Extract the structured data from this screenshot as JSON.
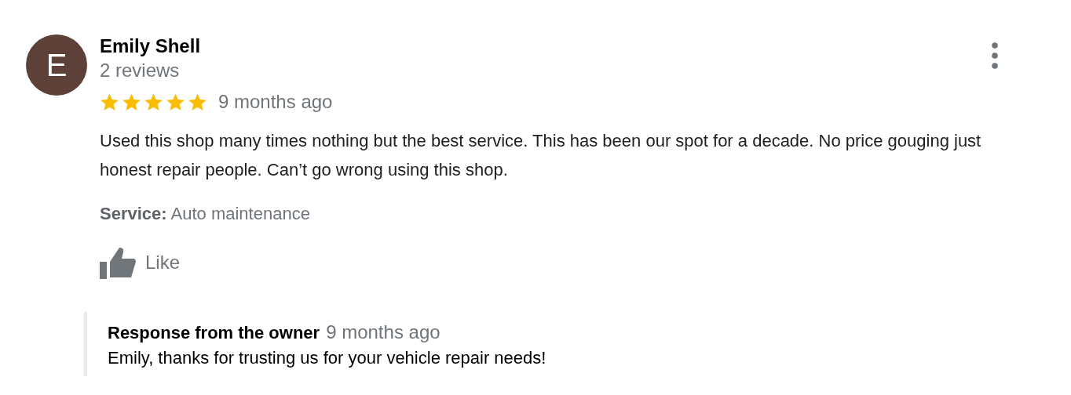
{
  "review": {
    "avatar_letter": "E",
    "author": "Emily Shell",
    "review_count": "2 reviews",
    "stars": 5,
    "time": "9 months ago",
    "text": "Used this shop many times nothing but the best service. This has been our spot for a decade. No price gouging just honest repair people. Can’t go wrong using this shop.",
    "service_label": "Service:",
    "service_value": "Auto maintenance",
    "like_label": "Like"
  },
  "owner_response": {
    "title": "Response from the owner",
    "time": "9 months ago",
    "text": "Emily, thanks for trusting us for your vehicle repair needs!"
  }
}
